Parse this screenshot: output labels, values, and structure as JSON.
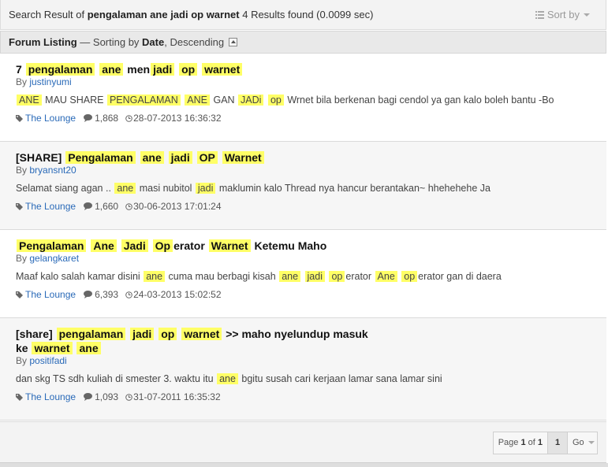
{
  "summary": {
    "prefix": "Search Result of ",
    "query": "pengalaman ane jadi op warnet",
    "results": " 4 Results found (0.0099 sec)"
  },
  "sort": {
    "label": "Sort by"
  },
  "listing": {
    "title": "Forum Listing",
    "sep": " — Sorting by ",
    "field": "Date",
    "comma": ", ",
    "order": "Descending"
  },
  "results": [
    {
      "title_parts": [
        {
          "t": "7 "
        },
        {
          "t": "pengalaman",
          "h": true
        },
        {
          "t": " "
        },
        {
          "t": "ane",
          "h": true
        },
        {
          "t": " men"
        },
        {
          "t": "jadi",
          "h": true
        },
        {
          "t": " "
        },
        {
          "t": "op",
          "h": true
        },
        {
          "t": " "
        },
        {
          "t": "warnet",
          "h": true
        }
      ],
      "by": "By ",
      "author": "justinyumi",
      "snippet_parts": [
        {
          "t": "ANE",
          "h": true
        },
        {
          "t": " MAU SHARE "
        },
        {
          "t": "PENGALAMAN",
          "h": true
        },
        {
          "t": " "
        },
        {
          "t": "ANE",
          "h": true
        },
        {
          "t": " GAN "
        },
        {
          "t": "JADi",
          "h": true
        },
        {
          "t": " "
        },
        {
          "t": "op",
          "h": true
        },
        {
          "t": " Wrnet bila berkenan bagi cendol ya gan kalo boleh bantu -Bo"
        }
      ],
      "forum": "The Lounge",
      "replies": "1,868",
      "date": "28-07-2013 16:36:32"
    },
    {
      "title_parts": [
        {
          "t": "[SHARE] "
        },
        {
          "t": "Pengalaman",
          "h": true
        },
        {
          "t": " "
        },
        {
          "t": "ane",
          "h": true
        },
        {
          "t": " "
        },
        {
          "t": "jadi",
          "h": true
        },
        {
          "t": " "
        },
        {
          "t": "OP",
          "h": true
        },
        {
          "t": " "
        },
        {
          "t": "Warnet",
          "h": true
        }
      ],
      "by": "By ",
      "author": "bryansnt20",
      "snippet_parts": [
        {
          "t": "Selamat siang agan .. "
        },
        {
          "t": "ane",
          "h": true
        },
        {
          "t": " masi nubitol "
        },
        {
          "t": "jadi",
          "h": true
        },
        {
          "t": " maklumin kalo Thread nya hancur berantakan~ hhehehehe Ja"
        }
      ],
      "forum": "The Lounge",
      "replies": "1,660",
      "date": "30-06-2013 17:01:24"
    },
    {
      "title_parts": [
        {
          "t": "Pengalaman",
          "h": true
        },
        {
          "t": " "
        },
        {
          "t": "Ane",
          "h": true
        },
        {
          "t": " "
        },
        {
          "t": "Jadi",
          "h": true
        },
        {
          "t": " "
        },
        {
          "t": "Op",
          "h": true
        },
        {
          "t": "erator "
        },
        {
          "t": "Warnet",
          "h": true
        },
        {
          "t": " Ketemu Maho"
        }
      ],
      "by": "By ",
      "author": "gelangkaret",
      "snippet_parts": [
        {
          "t": "Maaf kalo salah kamar disini "
        },
        {
          "t": "ane",
          "h": true
        },
        {
          "t": " cuma mau berbagi kisah "
        },
        {
          "t": "ane",
          "h": true
        },
        {
          "t": " "
        },
        {
          "t": "jadi",
          "h": true
        },
        {
          "t": " "
        },
        {
          "t": "op",
          "h": true
        },
        {
          "t": "erator "
        },
        {
          "t": "Ane",
          "h": true
        },
        {
          "t": " "
        },
        {
          "t": "op",
          "h": true
        },
        {
          "t": "erator gan di daera"
        }
      ],
      "forum": "The Lounge",
      "replies": "6,393",
      "date": "24-03-2013 15:02:52"
    },
    {
      "title_parts": [
        {
          "t": "[share] "
        },
        {
          "t": "pengalaman",
          "h": true
        },
        {
          "t": " "
        },
        {
          "t": "jadi",
          "h": true
        },
        {
          "t": " "
        },
        {
          "t": "op",
          "h": true
        },
        {
          "t": " "
        },
        {
          "t": "warnet",
          "h": true
        },
        {
          "t": " >> maho nyelundup masuk ke "
        },
        {
          "t": "warnet",
          "h": true
        },
        {
          "t": " "
        },
        {
          "t": "ane",
          "h": true
        }
      ],
      "by": "By ",
      "author": "positifadi",
      "snippet_parts": [
        {
          "t": "dan skg TS sdh kuliah di smester 3. waktu itu "
        },
        {
          "t": "ane",
          "h": true
        },
        {
          "t": " bgitu susah cari kerjaan lamar sana lamar sini"
        }
      ],
      "forum": "The Lounge",
      "replies": "1,093",
      "date": "31-07-2011 16:35:32"
    }
  ],
  "pager": {
    "label_prefix": "Page ",
    "current": "1",
    "of": " of ",
    "total": "1",
    "page_button": "1",
    "go": "Go"
  },
  "colors": {
    "highlight": "#ffff66",
    "link": "#2a6ab8"
  }
}
